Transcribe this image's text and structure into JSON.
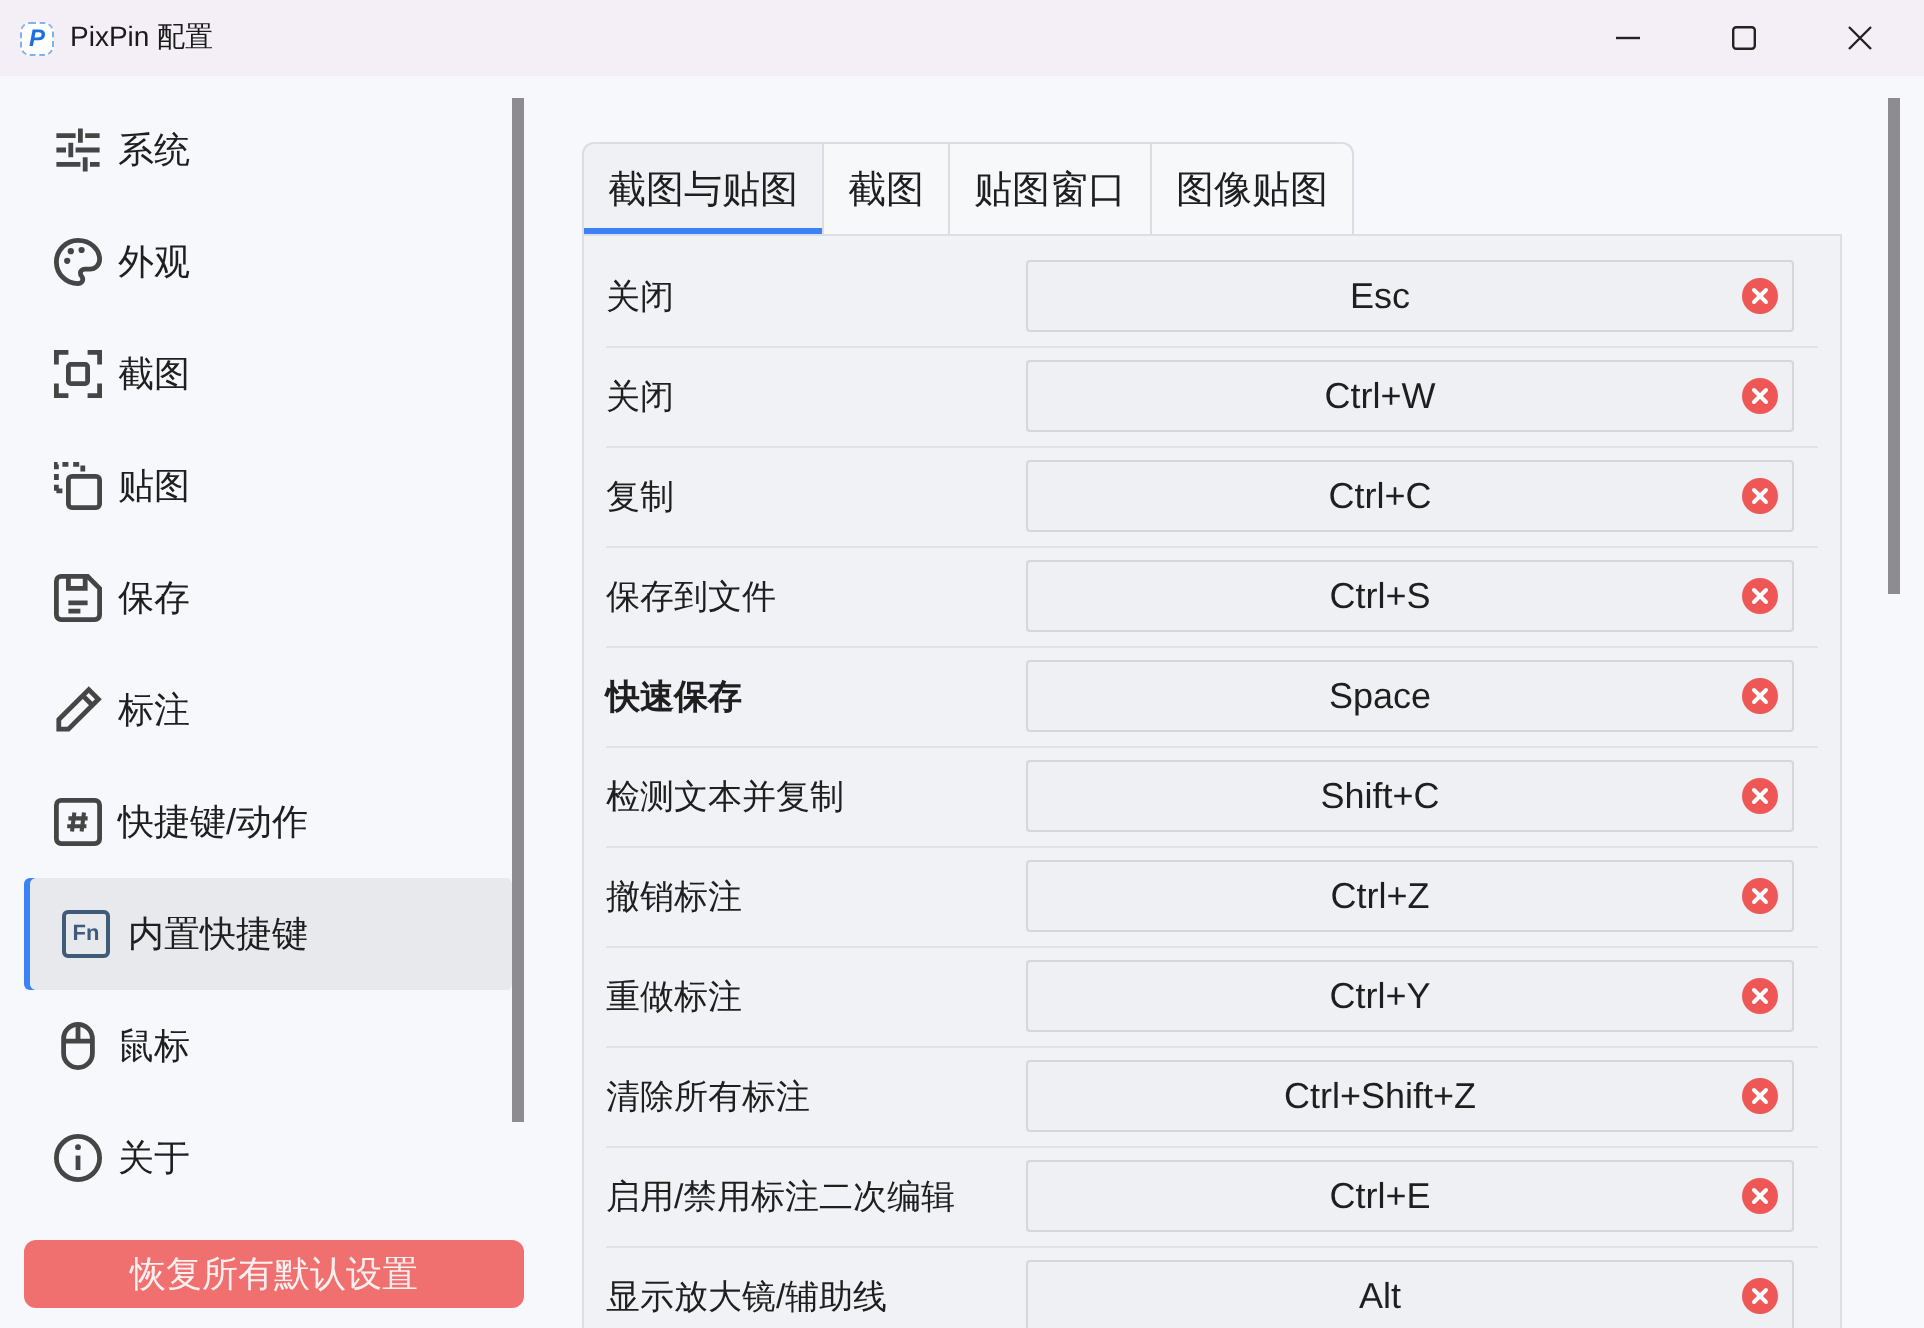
{
  "window": {
    "logo": "P",
    "title": "PixPin 配置"
  },
  "sidebar": {
    "items": [
      {
        "label": "系统",
        "selected": false
      },
      {
        "label": "外观",
        "selected": false
      },
      {
        "label": "截图",
        "selected": false
      },
      {
        "label": "贴图",
        "selected": false
      },
      {
        "label": "保存",
        "selected": false
      },
      {
        "label": "标注",
        "selected": false
      },
      {
        "label": "快捷键/动作",
        "selected": false
      },
      {
        "label": "内置快捷键",
        "selected": true,
        "icon_text": "Fn"
      },
      {
        "label": "鼠标",
        "selected": false
      },
      {
        "label": "关于",
        "selected": false
      }
    ],
    "reset_button": "恢复所有默认设置"
  },
  "tabs": [
    {
      "label": "截图与贴图",
      "selected": true
    },
    {
      "label": "截图",
      "selected": false
    },
    {
      "label": "贴图窗口",
      "selected": false
    },
    {
      "label": "图像贴图",
      "selected": false
    }
  ],
  "shortcuts": [
    {
      "action": "关闭",
      "key": "Esc",
      "bold": false
    },
    {
      "action": "关闭",
      "key": "Ctrl+W",
      "bold": false
    },
    {
      "action": "复制",
      "key": "Ctrl+C",
      "bold": false
    },
    {
      "action": "保存到文件",
      "key": "Ctrl+S",
      "bold": false
    },
    {
      "action": "快速保存",
      "key": "Space",
      "bold": true
    },
    {
      "action": "检测文本并复制",
      "key": "Shift+C",
      "bold": false
    },
    {
      "action": "撤销标注",
      "key": "Ctrl+Z",
      "bold": false
    },
    {
      "action": "重做标注",
      "key": "Ctrl+Y",
      "bold": false
    },
    {
      "action": "清除所有标注",
      "key": "Ctrl+Shift+Z",
      "bold": false
    },
    {
      "action": "启用/禁用标注二次编辑",
      "key": "Ctrl+E",
      "bold": false
    },
    {
      "action": "显示放大镜/辅助线",
      "key": "Alt",
      "bold": false
    }
  ]
}
